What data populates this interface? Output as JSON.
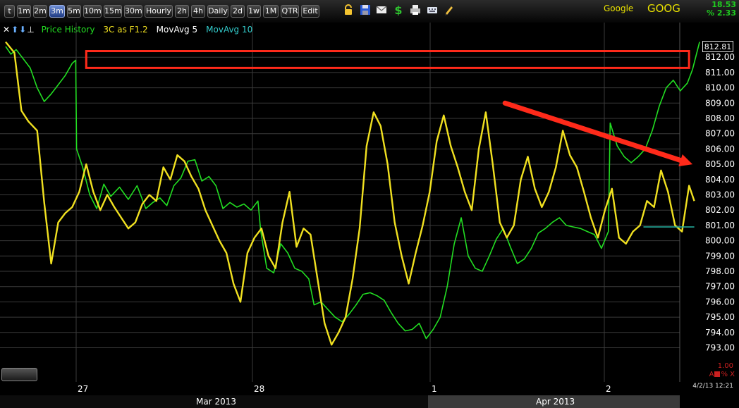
{
  "toolbar": {
    "timeframes": [
      {
        "label": "t",
        "active": false
      },
      {
        "label": "1m",
        "active": false
      },
      {
        "label": "2m",
        "active": false
      },
      {
        "label": "3m",
        "active": true
      },
      {
        "label": "5m",
        "active": false
      },
      {
        "label": "10m",
        "active": false
      },
      {
        "label": "15m",
        "active": false
      },
      {
        "label": "30m",
        "active": false
      },
      {
        "label": "Hourly",
        "active": false
      },
      {
        "label": "2h",
        "active": false
      },
      {
        "label": "4h",
        "active": false
      },
      {
        "label": "Daily",
        "active": false
      },
      {
        "label": "2d",
        "active": false
      },
      {
        "label": "1w",
        "active": false
      },
      {
        "label": "1M",
        "active": false
      },
      {
        "label": "QTR",
        "active": false
      },
      {
        "label": "Edit",
        "active": false
      }
    ],
    "icons": [
      "lock-icon",
      "save-icon",
      "mail-icon",
      "dollar-icon",
      "print-icon",
      "keyboard-icon",
      "pencil-icon"
    ]
  },
  "symbol": {
    "name": "Google",
    "ticker": "GOOG",
    "change": "18.53",
    "change_pct": "% 2.33"
  },
  "legend": {
    "close_glyph": "✕",
    "up_glyph": "⬆",
    "down_glyph": "⬇",
    "menu_glyph": "⊥",
    "items": [
      {
        "label": "Price History",
        "color": "#22dd22"
      },
      {
        "label": "3C as F1.2",
        "color": "#f0e020"
      },
      {
        "label": "MovAvg 5",
        "color": "#ffffff"
      },
      {
        "label": "MovAvg 10",
        "color": "#33cccc"
      }
    ]
  },
  "last_price": "812.81",
  "indicator": {
    "value": "1.00",
    "controls": "A",
    "controls_end": "% X"
  },
  "timestamp": "4/2/13 12:21",
  "months": [
    "Mar 2013",
    "Apr 2013"
  ],
  "colors": {
    "price": "#22dd22",
    "indicator": "#f0e020",
    "annotation": "#ff2a1a",
    "grid": "#3a3a3a",
    "axis_text": "#ffffff"
  },
  "chart_data": {
    "type": "line",
    "x": [
      "27",
      "28",
      "1",
      "2"
    ],
    "y_ticks": [
      "812.00",
      "811.00",
      "810.00",
      "809.00",
      "808.00",
      "807.00",
      "806.00",
      "805.00",
      "804.00",
      "803.00",
      "802.00",
      "801.00",
      "800.00",
      "799.00",
      "798.00",
      "797.00",
      "796.00",
      "795.00",
      "794.00",
      "793.00"
    ],
    "ylim": [
      792.5,
      814.0
    ],
    "series": [
      {
        "name": "Price History",
        "color": "#22dd22",
        "points": [
          [
            0.0,
            812.7
          ],
          [
            0.3,
            812.2
          ],
          [
            0.6,
            812.5
          ],
          [
            1.0,
            811.9
          ],
          [
            1.4,
            811.3
          ],
          [
            1.8,
            810.0
          ],
          [
            2.2,
            809.1
          ],
          [
            2.6,
            809.6
          ],
          [
            3.0,
            810.2
          ],
          [
            3.4,
            810.8
          ],
          [
            3.8,
            811.6
          ],
          [
            4.0,
            811.8
          ],
          [
            4.05,
            806.0
          ],
          [
            4.4,
            804.8
          ],
          [
            4.8,
            803.0
          ],
          [
            5.2,
            802.1
          ],
          [
            5.6,
            803.7
          ],
          [
            6.0,
            802.9
          ],
          [
            6.5,
            803.5
          ],
          [
            7.0,
            802.7
          ],
          [
            7.5,
            803.6
          ],
          [
            8.0,
            802.1
          ],
          [
            8.4,
            802.5
          ],
          [
            8.8,
            802.8
          ],
          [
            9.2,
            802.3
          ],
          [
            9.6,
            803.6
          ],
          [
            10.0,
            804.1
          ],
          [
            10.4,
            805.2
          ],
          [
            10.8,
            805.3
          ],
          [
            11.2,
            803.9
          ],
          [
            11.6,
            804.2
          ],
          [
            12.0,
            803.6
          ],
          [
            12.4,
            802.1
          ],
          [
            12.8,
            802.5
          ],
          [
            13.2,
            802.2
          ],
          [
            13.6,
            802.4
          ],
          [
            14.0,
            802.0
          ],
          [
            14.4,
            802.6
          ],
          [
            14.55,
            800.7
          ],
          [
            14.9,
            798.2
          ],
          [
            15.3,
            797.9
          ],
          [
            15.7,
            799.8
          ],
          [
            16.1,
            799.2
          ],
          [
            16.5,
            798.2
          ],
          [
            16.9,
            798.0
          ],
          [
            17.3,
            797.5
          ],
          [
            17.6,
            795.8
          ],
          [
            18.0,
            796.0
          ],
          [
            18.4,
            795.5
          ],
          [
            18.8,
            795.0
          ],
          [
            19.2,
            794.7
          ],
          [
            19.6,
            795.2
          ],
          [
            20.0,
            795.8
          ],
          [
            20.4,
            796.5
          ],
          [
            20.8,
            796.6
          ],
          [
            21.2,
            796.4
          ],
          [
            21.6,
            796.1
          ],
          [
            22.0,
            795.3
          ],
          [
            22.4,
            794.6
          ],
          [
            22.8,
            794.1
          ],
          [
            23.2,
            794.2
          ],
          [
            23.6,
            794.6
          ],
          [
            24.0,
            793.6
          ],
          [
            24.4,
            794.2
          ],
          [
            24.8,
            795.0
          ],
          [
            25.2,
            797.0
          ],
          [
            25.6,
            799.8
          ],
          [
            26.0,
            801.5
          ],
          [
            26.4,
            799.0
          ],
          [
            26.8,
            798.2
          ],
          [
            27.2,
            798.0
          ],
          [
            27.6,
            799.0
          ],
          [
            28.0,
            800.1
          ],
          [
            28.4,
            800.8
          ],
          [
            28.8,
            799.6
          ],
          [
            29.2,
            798.5
          ],
          [
            29.6,
            798.8
          ],
          [
            30.0,
            799.5
          ],
          [
            30.4,
            800.5
          ],
          [
            30.8,
            800.8
          ],
          [
            31.2,
            801.2
          ],
          [
            31.6,
            801.5
          ],
          [
            32.0,
            801.0
          ],
          [
            32.4,
            800.9
          ],
          [
            32.8,
            800.8
          ],
          [
            33.2,
            800.6
          ],
          [
            33.6,
            800.4
          ],
          [
            34.0,
            799.5
          ],
          [
            34.4,
            800.6
          ],
          [
            34.5,
            807.7
          ],
          [
            34.9,
            806.2
          ],
          [
            35.3,
            805.5
          ],
          [
            35.7,
            805.1
          ],
          [
            36.1,
            805.5
          ],
          [
            36.5,
            806.0
          ],
          [
            36.9,
            807.2
          ],
          [
            37.3,
            808.8
          ],
          [
            37.7,
            810.0
          ],
          [
            38.1,
            810.5
          ],
          [
            38.5,
            809.8
          ],
          [
            38.9,
            810.3
          ],
          [
            39.2,
            811.2
          ],
          [
            39.6,
            813.0
          ]
        ]
      },
      {
        "name": "3C as F1.2",
        "color": "#f0e020",
        "points": [
          [
            0.0,
            813.0
          ],
          [
            0.5,
            812.3
          ],
          [
            0.9,
            808.5
          ],
          [
            1.3,
            807.8
          ],
          [
            1.8,
            807.2
          ],
          [
            2.2,
            802.5
          ],
          [
            2.6,
            798.5
          ],
          [
            3.0,
            801.2
          ],
          [
            3.4,
            801.8
          ],
          [
            3.8,
            802.2
          ],
          [
            4.2,
            803.2
          ],
          [
            4.6,
            805.0
          ],
          [
            5.0,
            803.2
          ],
          [
            5.4,
            802.0
          ],
          [
            5.8,
            803.0
          ],
          [
            6.2,
            802.2
          ],
          [
            6.6,
            801.5
          ],
          [
            7.0,
            800.8
          ],
          [
            7.4,
            801.2
          ],
          [
            7.8,
            802.4
          ],
          [
            8.2,
            803.0
          ],
          [
            8.6,
            802.6
          ],
          [
            9.0,
            804.8
          ],
          [
            9.4,
            804.0
          ],
          [
            9.8,
            805.6
          ],
          [
            10.2,
            805.2
          ],
          [
            10.6,
            804.2
          ],
          [
            11.0,
            803.4
          ],
          [
            11.4,
            802.0
          ],
          [
            11.8,
            801.0
          ],
          [
            12.2,
            800.0
          ],
          [
            12.6,
            799.2
          ],
          [
            13.0,
            797.2
          ],
          [
            13.4,
            796.0
          ],
          [
            13.8,
            799.2
          ],
          [
            14.2,
            800.2
          ],
          [
            14.6,
            800.8
          ],
          [
            15.0,
            799.0
          ],
          [
            15.4,
            798.2
          ],
          [
            15.8,
            801.2
          ],
          [
            16.2,
            803.2
          ],
          [
            16.6,
            799.6
          ],
          [
            17.0,
            800.8
          ],
          [
            17.4,
            800.4
          ],
          [
            17.8,
            797.5
          ],
          [
            18.2,
            794.6
          ],
          [
            18.6,
            793.2
          ],
          [
            19.0,
            794.0
          ],
          [
            19.4,
            795.0
          ],
          [
            19.8,
            797.5
          ],
          [
            20.2,
            800.8
          ],
          [
            20.6,
            806.2
          ],
          [
            21.0,
            808.4
          ],
          [
            21.4,
            807.5
          ],
          [
            21.8,
            805.0
          ],
          [
            22.2,
            801.2
          ],
          [
            22.6,
            799.0
          ],
          [
            23.0,
            797.2
          ],
          [
            23.4,
            799.2
          ],
          [
            23.8,
            801.0
          ],
          [
            24.2,
            803.2
          ],
          [
            24.6,
            806.5
          ],
          [
            25.0,
            808.2
          ],
          [
            25.4,
            806.2
          ],
          [
            25.8,
            804.8
          ],
          [
            26.2,
            803.2
          ],
          [
            26.6,
            802.0
          ],
          [
            27.0,
            806.0
          ],
          [
            27.4,
            808.4
          ],
          [
            27.8,
            805.0
          ],
          [
            28.2,
            801.2
          ],
          [
            28.6,
            800.2
          ],
          [
            29.0,
            801.0
          ],
          [
            29.4,
            804.0
          ],
          [
            29.8,
            805.5
          ],
          [
            30.2,
            803.4
          ],
          [
            30.6,
            802.2
          ],
          [
            31.0,
            803.2
          ],
          [
            31.4,
            804.8
          ],
          [
            31.8,
            807.2
          ],
          [
            32.2,
            805.6
          ],
          [
            32.6,
            804.8
          ],
          [
            33.0,
            803.2
          ],
          [
            33.4,
            801.5
          ],
          [
            33.8,
            800.2
          ],
          [
            34.2,
            802.0
          ],
          [
            34.6,
            803.4
          ],
          [
            35.0,
            800.2
          ],
          [
            35.4,
            799.8
          ],
          [
            35.8,
            800.6
          ],
          [
            36.2,
            801.0
          ],
          [
            36.6,
            802.6
          ],
          [
            37.0,
            802.2
          ],
          [
            37.4,
            804.6
          ],
          [
            37.8,
            803.2
          ],
          [
            38.2,
            801.0
          ],
          [
            38.6,
            800.6
          ],
          [
            39.0,
            803.6
          ],
          [
            39.3,
            802.6
          ]
        ]
      },
      {
        "name": "",
        "color": "#22aa99",
        "points": [
          [
            36.4,
            800.9
          ],
          [
            39.3,
            800.9
          ]
        ]
      }
    ]
  },
  "annotations": {
    "rect": {
      "x0": 4.6,
      "x1": 39.0,
      "y_low": 811.3,
      "y_high": 812.4
    },
    "arrow": {
      "x0": 28.5,
      "y0": 809.0,
      "x1": 39.2,
      "y1": 805.0
    }
  }
}
